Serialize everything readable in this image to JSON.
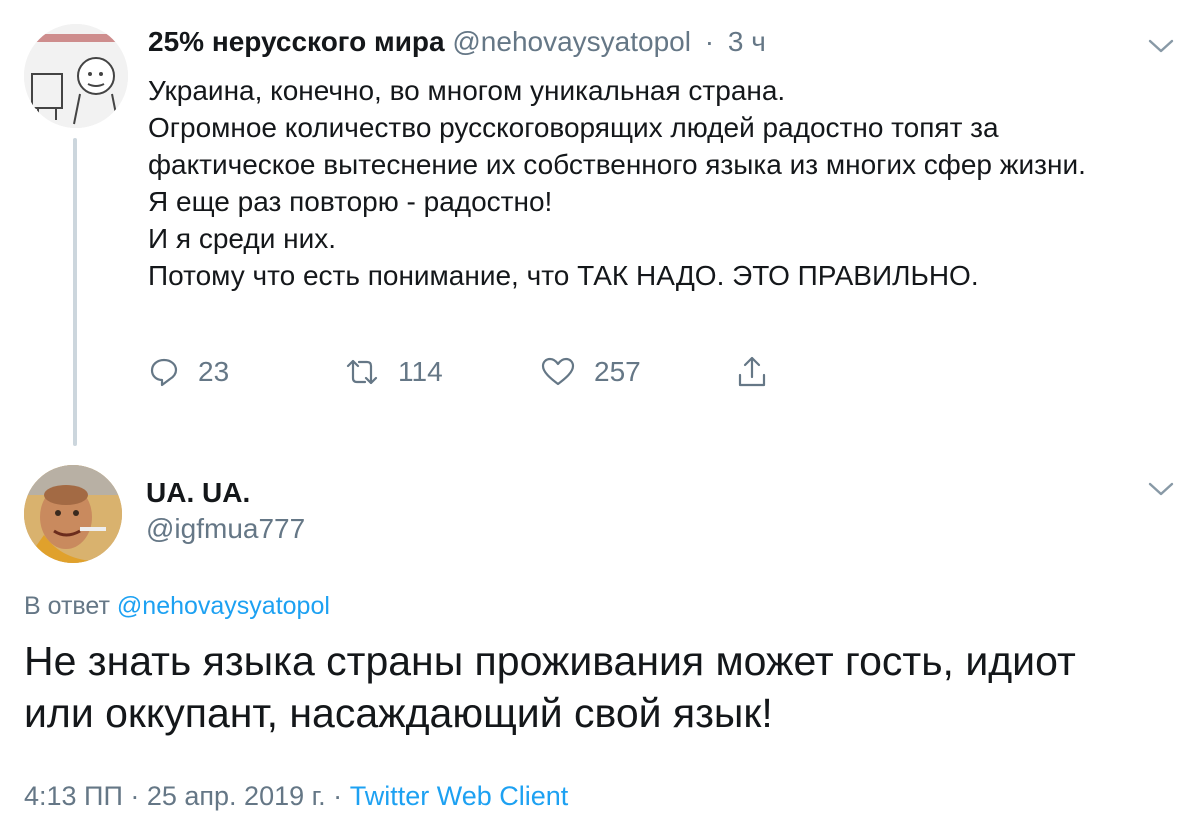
{
  "tweet1": {
    "display_name": "25% нерусского мира",
    "handle": "@nehovaysyatopol",
    "separator": "·",
    "time": "3 ч",
    "lines": [
      "Украина, конечно, во многом уникальная страна.",
      "Огромное количество русскоговорящих людей радостно топят за фактическое вытеснение их собственного языка из многих сфер жизни.",
      "Я еще раз повторю - радостно!",
      "И я среди них.",
      "Потому что есть понимание, что ТАК НАДО. ЭТО ПРАВИЛЬНО."
    ],
    "replies": "23",
    "retweets": "114",
    "likes": "257",
    "icons": [
      "reply-icon",
      "retweet-icon",
      "like-icon",
      "share-icon",
      "chevron-down-icon"
    ]
  },
  "tweet2": {
    "display_name": "UA. UA.",
    "handle": "@igfmua777",
    "reply_prefix": "В ответ",
    "reply_to": "@nehovaysyatopol",
    "text_lines": [
      "Не знать языка страны проживания может гость, идиот",
      "или оккупант, насаждающий свой язык!"
    ],
    "timestamp": "4:13 ПП · 25 апр. 2019 г. ·",
    "client": "Twitter Web Client"
  },
  "colors": {
    "text": "#14171a",
    "secondary": "#657786",
    "link": "#1da1f2",
    "thread_line": "#ccd6dd"
  }
}
